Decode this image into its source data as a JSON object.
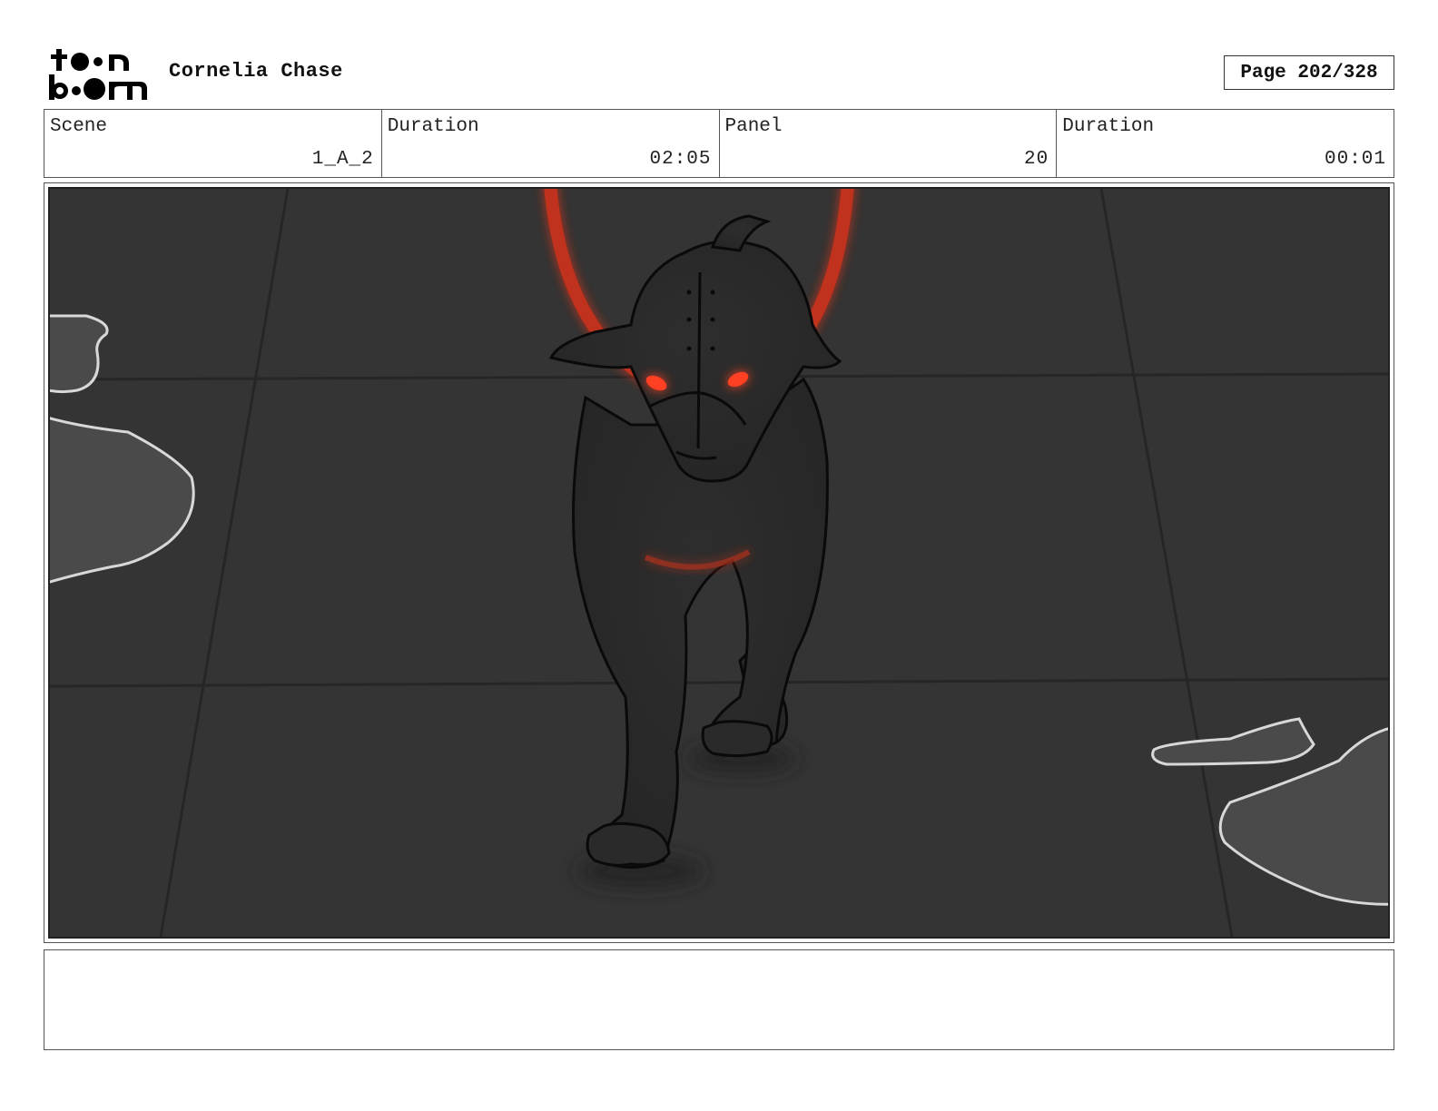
{
  "header": {
    "logo_text_line1": "toon",
    "logo_text_line2": "boom",
    "project_title": "Cornelia Chase",
    "page_label": "Page 202/328"
  },
  "info": [
    {
      "label": "Scene",
      "value": "1_A_2"
    },
    {
      "label": "Duration",
      "value": "02:05"
    },
    {
      "label": "Panel",
      "value": "20"
    },
    {
      "label": "Duration",
      "value": "00:01"
    }
  ],
  "panel": {
    "image_subject": "dark-hound-glowing-eyes-illustration",
    "background_color": "#333333",
    "glow_color": "#e0321a",
    "outline_color": "#dddddd"
  },
  "notes": {
    "text": ""
  }
}
